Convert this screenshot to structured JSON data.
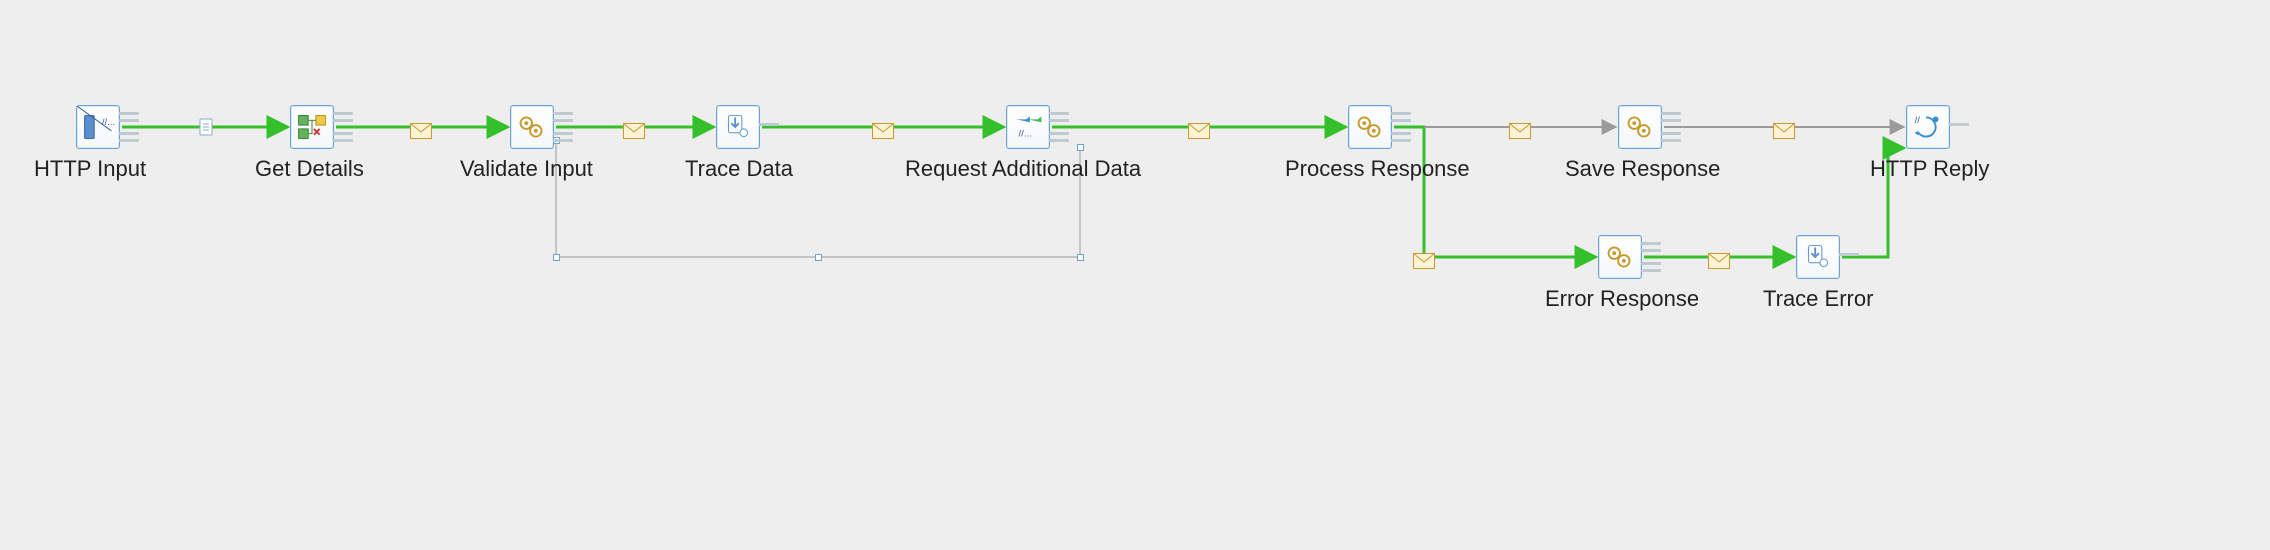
{
  "nodes": {
    "http_input": {
      "label": "HTTP Input"
    },
    "get_details": {
      "label": "Get Details"
    },
    "validate": {
      "label": "Validate Input"
    },
    "trace_data": {
      "label": "Trace Data"
    },
    "request_add": {
      "label": "Request Additional Data"
    },
    "process_resp": {
      "label": "Process Response"
    },
    "save_resp": {
      "label": "Save Response"
    },
    "http_reply": {
      "label": "HTTP Reply"
    },
    "error_resp": {
      "label": "Error Response"
    },
    "trace_error": {
      "label": "Trace Error"
    }
  },
  "colors": {
    "active_link": "#34c02a",
    "inactive_link": "#9a9a9a",
    "node_border": "#6aa3d6"
  }
}
